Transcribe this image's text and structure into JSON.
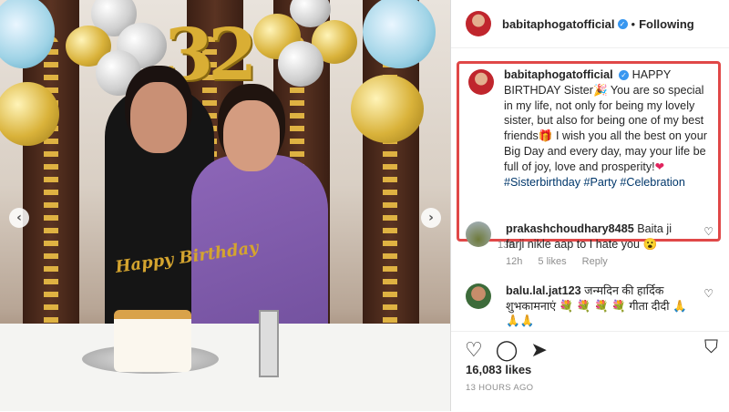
{
  "post": {
    "username": "babitaphogatofficial",
    "follow_label": "Following",
    "separator": "•",
    "caption_username": "babitaphogatofficial",
    "caption_text_1": "HAPPY BIRTHDAY Sister🎉 You are so special in my life, not only for being my lovely sister, but also for being one of my best friends🎁 I wish you all the best on your Big Day and every day, may your life be full of joy, love and prosperity!",
    "caption_heart": "❤",
    "hashtag_1": "#Sisterbirthday",
    "hashtag_2": "#Party",
    "hashtag_3": "#Celebration",
    "caption_time": "13h"
  },
  "photo": {
    "balloon_digits": "32",
    "cake_topper": "Happy Birthday",
    "prev_arrow": "‹",
    "next_arrow": "›"
  },
  "comments": [
    {
      "username": "prakashchoudhary8485",
      "text": "Baita ji farji nikle aap to I hate you 😮",
      "time": "12h",
      "likes": "5 likes",
      "reply": "Reply"
    },
    {
      "username": "balu.lal.jat123",
      "text": "जन्मदिन की हार्दिक शुभकामनाएं 💐 💐 💐 💐 गीता दीदी 🙏🙏🙏"
    }
  ],
  "actions": {
    "like_icon": "♡",
    "comment_icon": "◯",
    "share_icon": "➤",
    "bookmark_icon": "⛉",
    "likes_count": "16,083 likes",
    "posted_ago": "13 HOURS AGO"
  },
  "colors": {
    "highlight_border": "#e04848",
    "verified_badge": "#3897f0",
    "hashtag": "#00376b"
  }
}
